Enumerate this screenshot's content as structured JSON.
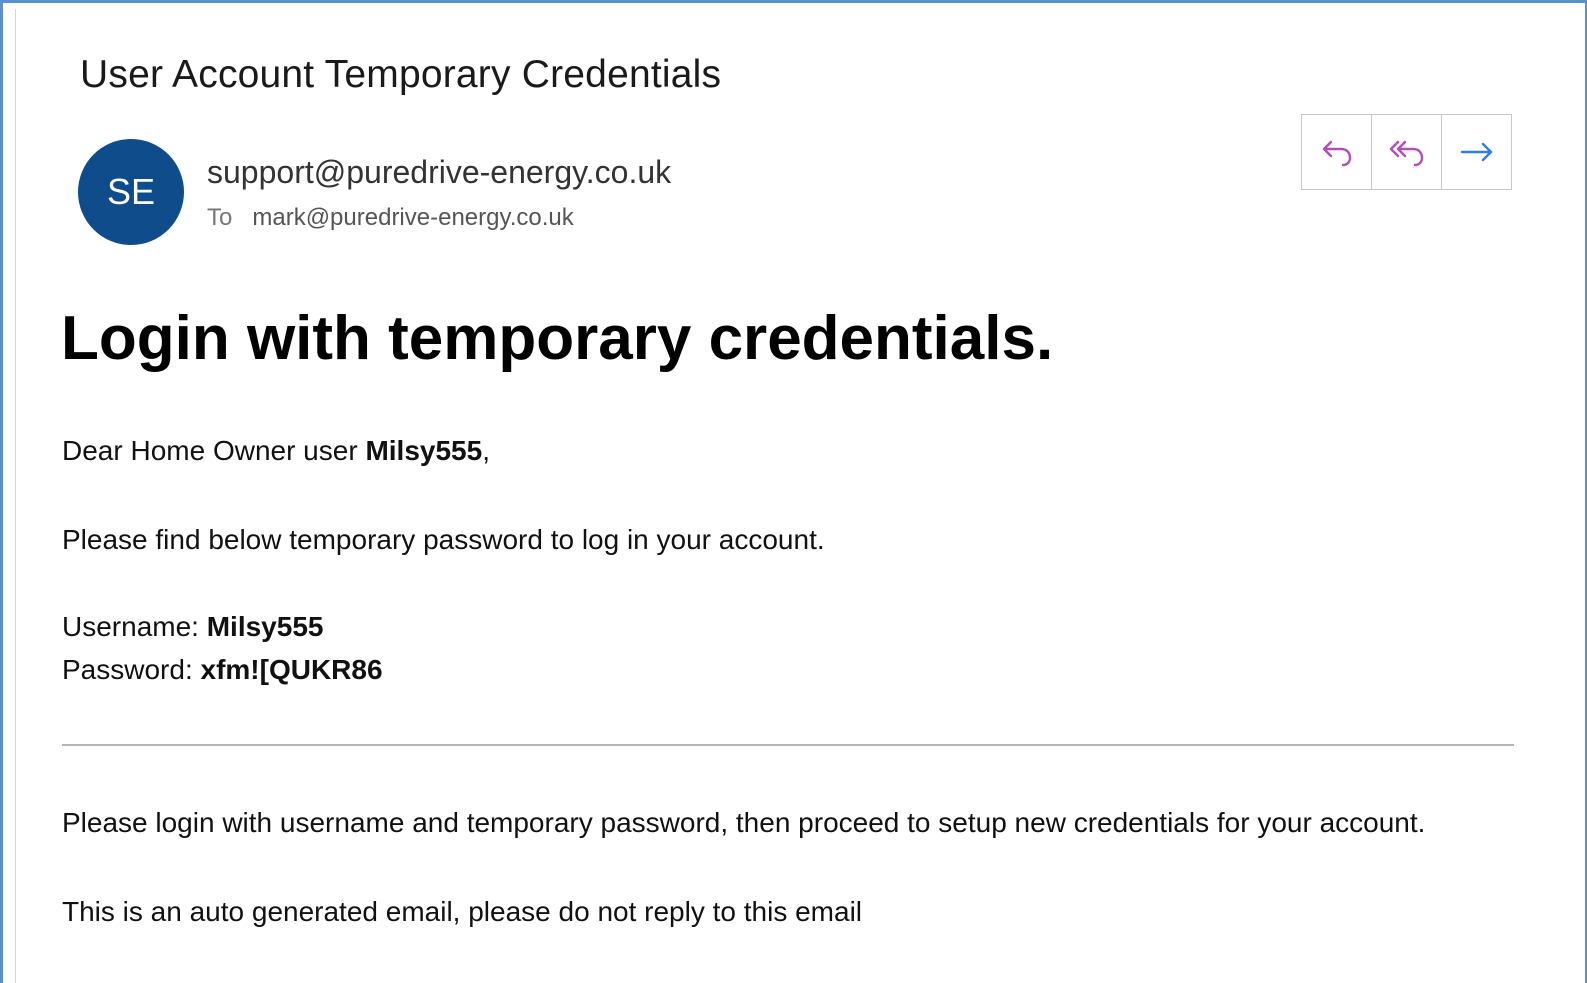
{
  "email": {
    "subject": "User Account Temporary Credentials",
    "avatar_initials": "SE",
    "sender": "support@puredrive-energy.co.uk",
    "to_label": "To",
    "recipient": "mark@puredrive-energy.co.uk",
    "actions": [
      {
        "name": "reply",
        "icon": "reply-icon",
        "color": "#b04fb8"
      },
      {
        "name": "reply-all",
        "icon": "reply-all-icon",
        "color": "#b04fb8"
      },
      {
        "name": "forward",
        "icon": "forward-icon",
        "color": "#2f7fd6"
      }
    ]
  },
  "body": {
    "headline": "Login with temporary credentials.",
    "greeting_prefix": "Dear Home Owner user ",
    "greeting_user": "Milsy555",
    "greeting_suffix": ",",
    "instruction": "Please find below temporary password to log in your account.",
    "username_label": "Username: ",
    "username_value": "Milsy555",
    "password_label": "Password: ",
    "password_value": "xfm![QUKR86",
    "setup_note": "Please login with username and temporary password, then proceed to setup new credentials for your account.",
    "auto_note": "This is an auto generated email, please do not reply to this email"
  },
  "colors": {
    "avatar_bg": "#0e4c8c",
    "frame_border": "#5b8fd0",
    "reply_icon": "#b04fb8",
    "forward_icon": "#2f7fd6"
  }
}
